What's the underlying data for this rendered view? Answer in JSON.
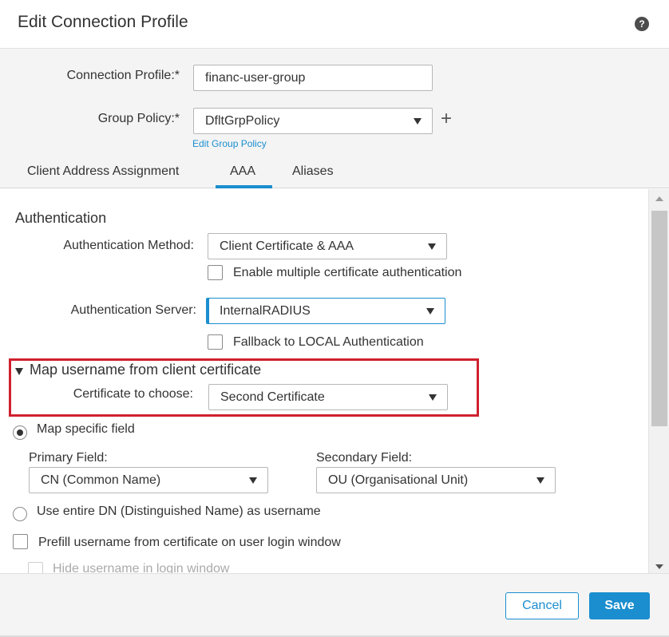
{
  "dialog": {
    "title": "Edit Connection Profile",
    "help_icon": "?"
  },
  "profile": {
    "connection_profile_label": "Connection Profile:*",
    "connection_profile_value": "financ-user-group",
    "group_policy_label": "Group Policy:*",
    "group_policy_value": "DfltGrpPolicy",
    "add_icon": "+",
    "edit_group_policy_link": "Edit Group Policy"
  },
  "tabs": [
    {
      "label": "Client Address Assignment",
      "active": false
    },
    {
      "label": "AAA",
      "active": true
    },
    {
      "label": "Aliases",
      "active": false
    }
  ],
  "authentication": {
    "section_title": "Authentication",
    "method_label": "Authentication Method:",
    "method_value": "Client Certificate & AAA",
    "multi_cert_label": "Enable multiple certificate authentication",
    "multi_cert_checked": false,
    "server_label": "Authentication Server:",
    "server_value": "InternalRADIUS",
    "fallback_label": "Fallback to LOCAL Authentication",
    "fallback_checked": false
  },
  "map_username": {
    "section_title": "Map username from client certificate",
    "cert_label": "Certificate to choose:",
    "cert_value": "Second Certificate",
    "map_specific_label": "Map specific field",
    "map_specific_selected": true,
    "primary_field_label": "Primary Field:",
    "primary_field_value": "CN (Common Name)",
    "secondary_field_label": "Secondary Field:",
    "secondary_field_value": "OU (Organisational Unit)",
    "entire_dn_label": "Use entire DN (Distinguished Name) as username",
    "entire_dn_selected": false,
    "prefill_label": "Prefill username from certificate on user login window",
    "prefill_checked": false,
    "hide_label": "Hide username in login window",
    "hide_checked": false
  },
  "footer": {
    "cancel_label": "Cancel",
    "save_label": "Save"
  },
  "colors": {
    "accent": "#1a8ecf",
    "highlight": "#d0202e",
    "panel_bg": "#f4f4f4"
  }
}
